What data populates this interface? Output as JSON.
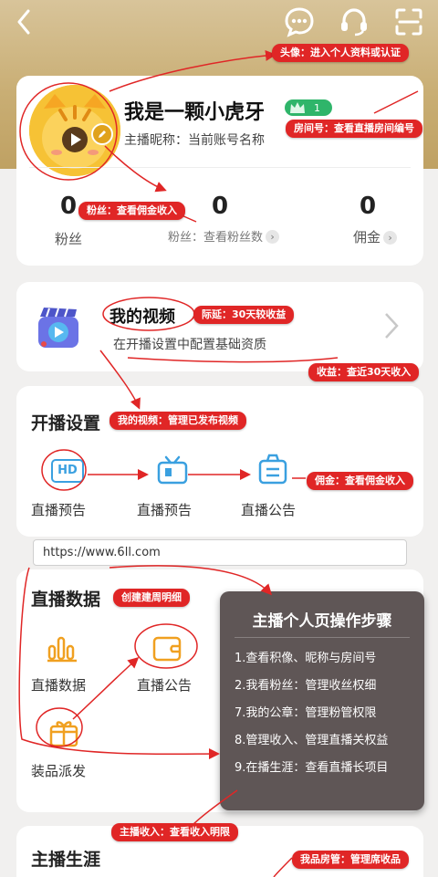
{
  "header": {
    "icons": [
      "back-arrow-icon",
      "chat-bubble-icon",
      "headset-icon",
      "scan-icon"
    ]
  },
  "profile": {
    "name": "我是一颗小虎牙",
    "level": "1",
    "nickname_line": "主播昵称：当前账号名称",
    "stats": [
      {
        "value": "0",
        "label": "粉丝"
      },
      {
        "value": "0",
        "label": "粉丝：查看粉丝数"
      },
      {
        "value": "0",
        "label": "佣金"
      }
    ]
  },
  "video": {
    "title": "我的视频",
    "subtitle": "在开播设置中配置基础资质"
  },
  "live_settings": {
    "title": "开播设置",
    "items": [
      {
        "label": "直播预告",
        "icon": "hd-icon"
      },
      {
        "label": "直播预告",
        "icon": "tv-icon"
      },
      {
        "label": "直播公告",
        "icon": "notice-bag-icon"
      }
    ]
  },
  "url": "https://www.6ll.com",
  "live_data": {
    "title": "直播数据",
    "items": [
      {
        "label": "直播数据",
        "icon": "bar-chart-icon"
      },
      {
        "label": "直播公告",
        "icon": "wallet-icon"
      },
      {
        "label": "装品派发",
        "icon": "gift-box-icon"
      }
    ]
  },
  "career": {
    "title": "主播生涯"
  },
  "steps_panel": {
    "title": "主播个人页操作步骤",
    "steps": [
      "1.查看积像、昵称与房间号",
      "2.我看粉丝：管理收丝权细",
      "7.我的公章：管理粉管权限",
      "8.管理收入、管理直播关权益",
      "9.在播生涯：查看直播长项目"
    ]
  },
  "annotations": {
    "avatar": "头像：进入个人资料或认证",
    "room": "房间号：查看直播房间编号",
    "fans": "粉丝：查看佣金收入",
    "video_income": "际延：30天较收益",
    "income30": "收益：查近30天收入",
    "my_video": "我的视频：管理已发布视频",
    "commission": "佣金：查看佣金收入",
    "live_data_tag": "创建建周明细",
    "live_income": "主播收入：查看收入明限",
    "room_manage": "我品房管：管理席收品"
  },
  "colors": {
    "accent_red": "#e02626",
    "brand_gold": "#c9ae74",
    "panel_gray": "#5f5656"
  }
}
